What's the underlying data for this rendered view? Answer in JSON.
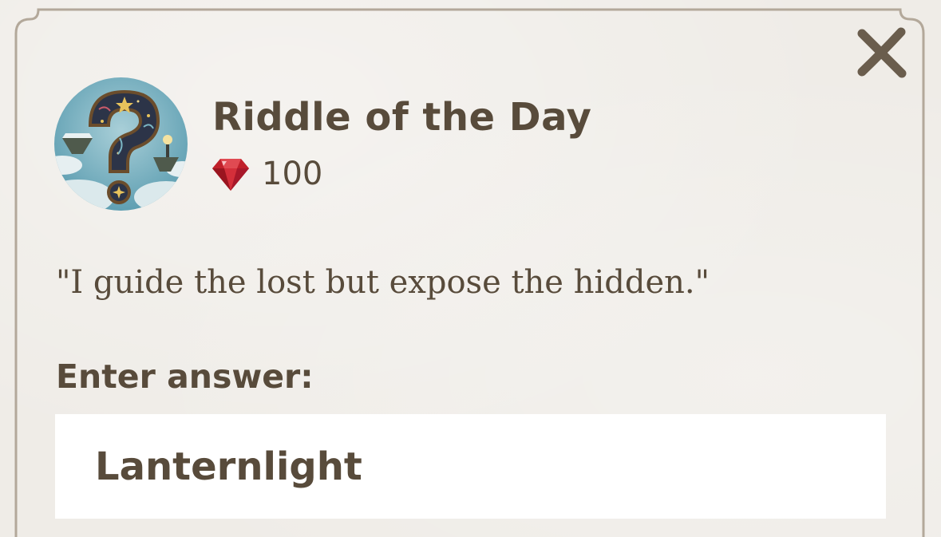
{
  "dialog": {
    "title": "Riddle of the Day",
    "reward": {
      "icon": "ruby-gem-icon",
      "value": "100"
    },
    "riddle_text": "\"I guide the lost but expose the hidden.\"",
    "answer_label": "Enter answer:",
    "answer_value": "Lanternlight",
    "close_icon": "close-icon"
  },
  "colors": {
    "text": "#584b3b",
    "background": "#efece7",
    "frame": "#b3a89a",
    "gem": "#c0202a",
    "input_background": "#ffffff"
  }
}
